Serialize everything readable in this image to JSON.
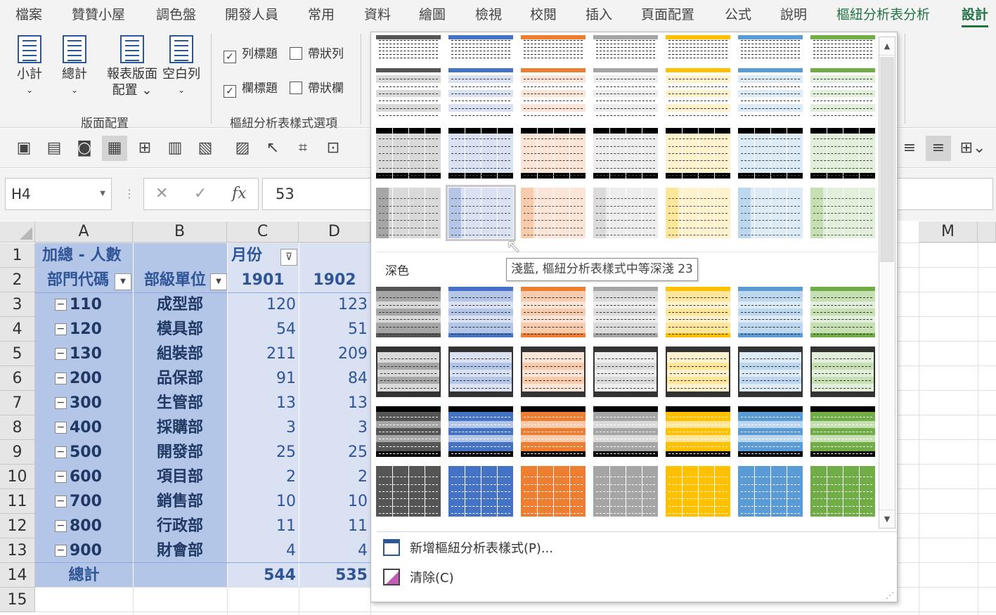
{
  "tabs": [
    "檔案",
    "贊贊小屋",
    "調色盤",
    "開發人員",
    "常用",
    "資料",
    "繪圖",
    "檢視",
    "校閱",
    "插入",
    "頁面配置",
    "公式",
    "說明",
    "樞紐分析表分析",
    "設計"
  ],
  "ribbon": {
    "layout_buttons": [
      {
        "label": "小計",
        "chevron": "⌄"
      },
      {
        "label": "總計",
        "chevron": "⌄"
      },
      {
        "label": "報表版面\n配置 ⌄",
        "chevron": ""
      },
      {
        "label": "空白列",
        "chevron": "⌄"
      }
    ],
    "layout_group": "版面配置",
    "options": [
      {
        "label": "列標題",
        "checked": true
      },
      {
        "label": "帶狀列",
        "checked": false
      },
      {
        "label": "欄標題",
        "checked": true
      },
      {
        "label": "帶狀欄",
        "checked": false
      }
    ],
    "options_group": "樞紐分析表樣式選項"
  },
  "formula_bar": {
    "name_box": "H4",
    "cancel": "✕",
    "enter": "✓",
    "fx": "fx",
    "value": "53"
  },
  "grid": {
    "columns": [
      "A",
      "B",
      "C",
      "D",
      "M"
    ],
    "rows": [
      "1",
      "2",
      "3",
      "4",
      "5",
      "6",
      "7",
      "8",
      "9",
      "10",
      "11",
      "12",
      "13",
      "14",
      "15"
    ],
    "pivot": {
      "a1": "加總 - 人數",
      "c1": "月份",
      "a2": "部門代碼",
      "b2": "部級單位",
      "c2": "1901",
      "d2": "1902",
      "data": [
        [
          "110",
          "成型部",
          "120",
          "123"
        ],
        [
          "120",
          "模具部",
          "54",
          "51"
        ],
        [
          "130",
          "組裝部",
          "211",
          "209"
        ],
        [
          "200",
          "品保部",
          "91",
          "84"
        ],
        [
          "300",
          "生管部",
          "13",
          "13"
        ],
        [
          "400",
          "採購部",
          "3",
          "3"
        ],
        [
          "500",
          "開發部",
          "25",
          "25"
        ],
        [
          "600",
          "項目部",
          "2",
          "2"
        ],
        [
          "700",
          "銷售部",
          "10",
          "10"
        ],
        [
          "800",
          "行政部",
          "11",
          "11"
        ],
        [
          "900",
          "財會部",
          "4",
          "4"
        ]
      ],
      "total_label": "總計",
      "total_c": "544",
      "total_d": "535"
    }
  },
  "gallery": {
    "section_dark": "深色",
    "tooltip": "淺藍, 樞紐分析表樣式中等深淺 23",
    "new_style": "新增樞紐分析表樣式(P)...",
    "clear": "清除(C)",
    "colors": [
      "#555555",
      "#4472c4",
      "#ed7d31",
      "#a5a5a5",
      "#ffc000",
      "#5b9bd5",
      "#70ad47"
    ],
    "light_tints": [
      "#d9d9d9",
      "#d9e1f2",
      "#fce4d6",
      "#ededed",
      "#fff2cc",
      "#ddebf7",
      "#e2efda"
    ],
    "mid_tints": [
      "#a6a6a6",
      "#b4c6e7",
      "#f8cbad",
      "#dbdbdb",
      "#ffe699",
      "#bdd7ee",
      "#c6e0b4"
    ]
  }
}
